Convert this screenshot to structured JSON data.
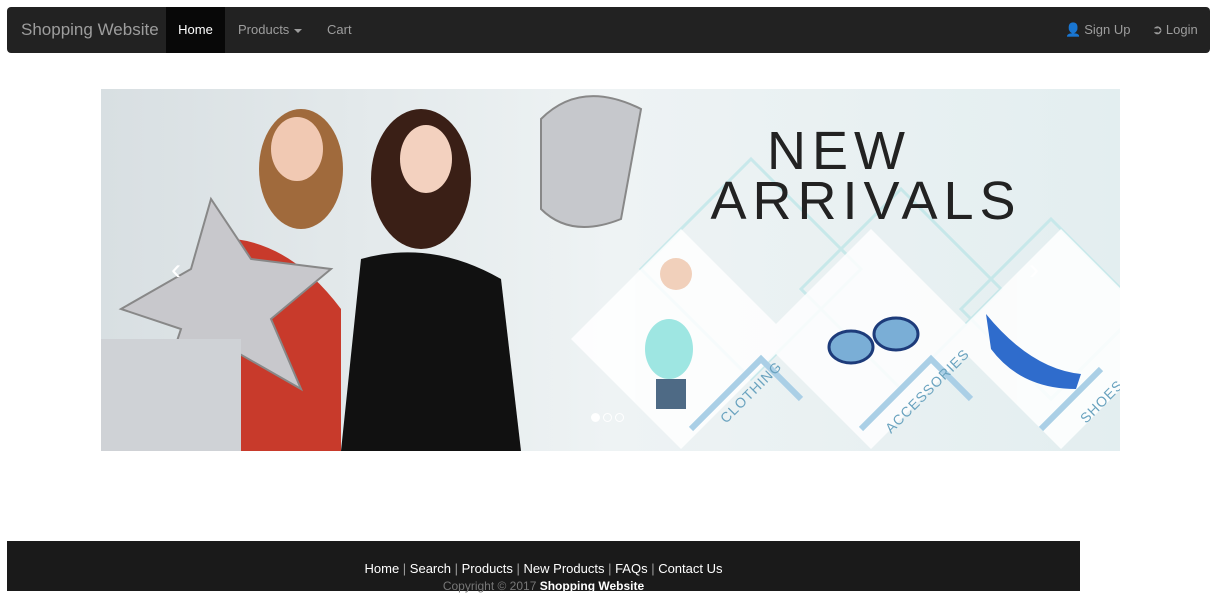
{
  "navbar": {
    "brand": "Shopping Website",
    "home": "Home",
    "products": "Products",
    "cart": "Cart",
    "signup": "Sign Up",
    "login": "Login",
    "signup_icon": "user-icon",
    "login_icon": "login-icon"
  },
  "carousel": {
    "headline_1": "NEW",
    "headline_2": "ARRIVALS",
    "category_1": "CLOTHING",
    "category_2": "ACCESSORIES",
    "category_3": "SHOES",
    "prev_icon": "chevron-left-icon",
    "next_icon": "chevron-right-icon",
    "slides": 3,
    "active_slide": 1
  },
  "footer": {
    "links": [
      "Home",
      "Search",
      "Products",
      "New Products",
      "FAQs",
      "Contact Us"
    ],
    "copyright_prefix": "Copyright © 2017",
    "copyright_brand": "Shopping Website"
  }
}
